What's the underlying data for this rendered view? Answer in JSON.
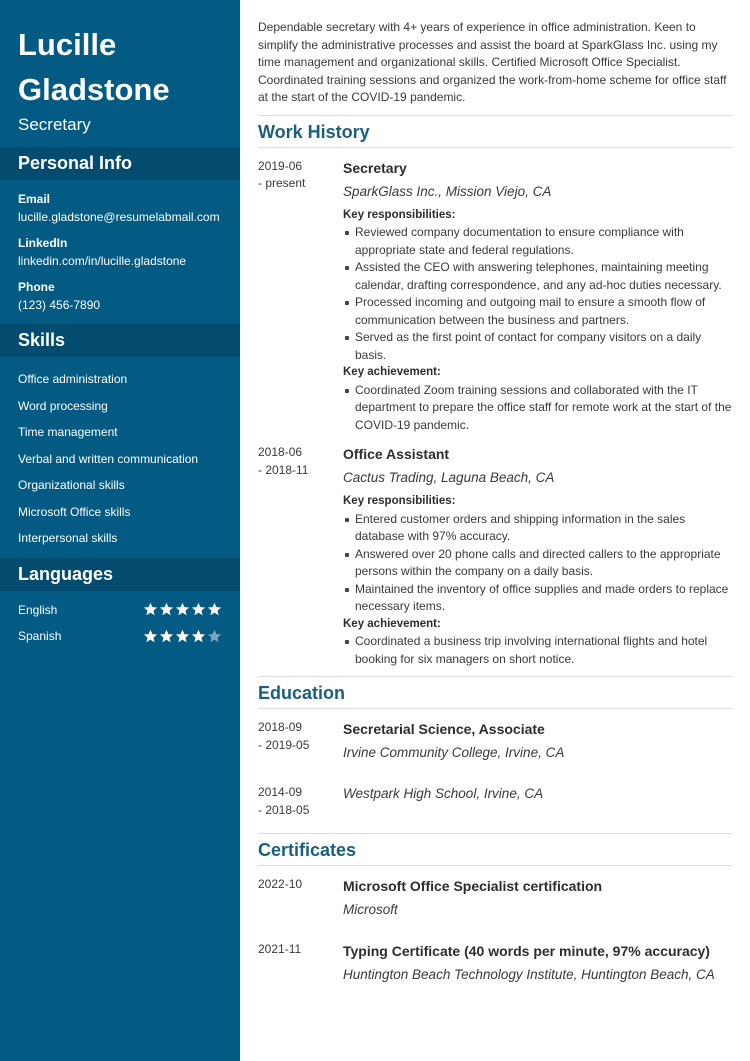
{
  "sidebar": {
    "name_line1": "Lucille",
    "name_line2": "Gladstone",
    "title": "Secretary",
    "personal_info": {
      "heading": "Personal Info",
      "email_label": "Email",
      "email": "lucille.gladstone@resumelabmail.com",
      "linkedin_label": "LinkedIn",
      "linkedin": "linkedin.com/in/lucille.gladstone",
      "phone_label": "Phone",
      "phone": "(123) 456-7890"
    },
    "skills": {
      "heading": "Skills",
      "items": [
        "Office administration",
        "Word processing",
        "Time management",
        "Verbal and written communication",
        "Organizational skills",
        "Microsoft Office skills",
        "Interpersonal skills"
      ]
    },
    "languages": {
      "heading": "Languages",
      "items": [
        {
          "name": "English",
          "rating": 5,
          "max": 5
        },
        {
          "name": "Spanish",
          "rating": 4,
          "max": 5
        }
      ]
    }
  },
  "colors": {
    "sidebar": "#035a83",
    "sidebar_header": "#034c70",
    "heading_accent": "#1a5f80",
    "star_filled": "#ffffff",
    "star_empty": "#7fa6c0"
  },
  "main": {
    "summary": "Dependable secretary with 4+ years of experience in office administration. Keen to simplify the administrative processes and assist the board at SparkGlass Inc. using my time management and organizational skills. Certified Microsoft Office Specialist. Coordinated training sessions and organized the work-from-home scheme for office staff at the start of the COVID-19 pandemic.",
    "work_history": {
      "heading": "Work History",
      "entries": [
        {
          "date_start": "2019-06",
          "date_end": "- present",
          "title": "Secretary",
          "company": "SparkGlass Inc., Mission Viejo, CA",
          "resp_label": "Key responsibilities:",
          "responsibilities": [
            "Reviewed company documentation to ensure compliance with appropriate state and federal regulations.",
            "Assisted the CEO with answering telephones, maintaining meeting calendar, drafting correspondence, and any ad-hoc duties necessary.",
            "Processed incoming and outgoing mail to ensure a smooth flow of communication between the business and partners.",
            "Served as the first point of contact for company visitors on a daily basis."
          ],
          "ach_label": "Key achievement:",
          "achievements": [
            "Coordinated Zoom training sessions and collaborated with the IT department to prepare the office staff for remote work at the start of the COVID-19 pandemic."
          ]
        },
        {
          "date_start": "2018-06",
          "date_end": "- 2018-11",
          "title": "Office Assistant",
          "company": "Cactus Trading, Laguna Beach, CA",
          "resp_label": "Key responsibilities:",
          "responsibilities": [
            "Entered customer orders and shipping information in the sales database with 97% accuracy.",
            "Answered over 20 phone calls and directed callers to the appropriate persons within the company on a daily basis.",
            "Maintained the inventory of office supplies and made orders to replace necessary items."
          ],
          "ach_label": "Key achievement:",
          "achievements": [
            "Coordinated a business trip involving international flights and hotel booking for six managers on short notice."
          ]
        }
      ]
    },
    "education": {
      "heading": "Education",
      "entries": [
        {
          "date_start": "2018-09",
          "date_end": "- 2019-05",
          "degree": "Secretarial Science, Associate",
          "school": "Irvine Community College, Irvine, CA"
        },
        {
          "date_start": "2014-09",
          "date_end": "- 2018-05",
          "degree": "",
          "school": "Westpark High School, Irvine, CA"
        }
      ]
    },
    "certificates": {
      "heading": "Certificates",
      "entries": [
        {
          "date": "2022-10",
          "name": "Microsoft Office Specialist certification",
          "issuer": "Microsoft"
        },
        {
          "date": "2021-11",
          "name": "Typing Certificate (40 words per minute, 97% accuracy)",
          "issuer": "Huntington Beach Technology Institute, Huntington Beach, CA"
        }
      ]
    }
  }
}
